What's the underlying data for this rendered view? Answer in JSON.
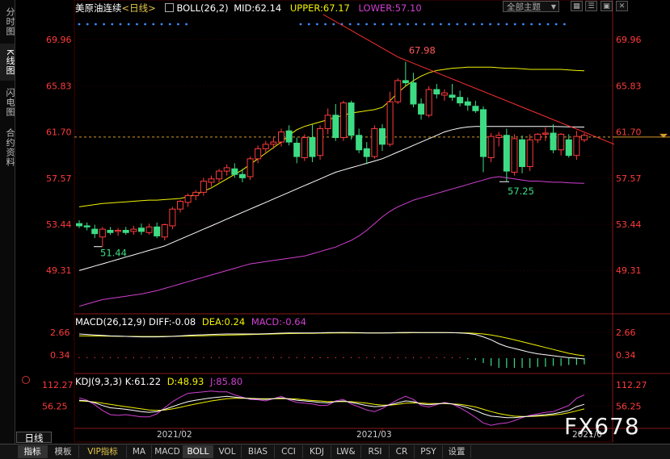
{
  "left_rail": [
    {
      "label": "分时图",
      "active": false
    },
    {
      "label": "K线图",
      "active": true
    },
    {
      "label": "闪电图",
      "active": false
    },
    {
      "label": "合约资料",
      "active": false
    }
  ],
  "header": {
    "instrument": "美原油连续",
    "period": "<日线>",
    "indicator": "BOLL(26,2)",
    "mid": "MID:62.14",
    "upper": "UPPER:67.17",
    "lower": "LOWER:57.10",
    "theme": "全部主题",
    "theme_arrow": "▼"
  },
  "macd_header": {
    "name": "MACD(26,12,9)",
    "diff": "DIFF:-0.08",
    "dea": "DEA:0.24",
    "macd": "MACD:-0.64"
  },
  "kdj_header": {
    "name": "KDJ(9,3,3)",
    "k": "K:61.22",
    "d": "D:48.93",
    "j": "J:85.80"
  },
  "date_labels": [
    "2021/02",
    "2021/03",
    "2021/0"
  ],
  "period_label": "日线",
  "bottom_tabs": [
    {
      "label": "指标",
      "active": true
    },
    {
      "label": "模板",
      "active": false
    },
    {
      "label": "VIP指标",
      "active": false,
      "vip": true
    },
    {
      "label": "MA",
      "active": false
    },
    {
      "label": "MACD",
      "active": false
    },
    {
      "label": "BOLL",
      "active": true
    },
    {
      "label": "VOL",
      "active": false
    },
    {
      "label": "BIAS",
      "active": false
    },
    {
      "label": "CCI",
      "active": false
    },
    {
      "label": "KDJ",
      "active": false
    },
    {
      "label": "LW&",
      "active": false
    },
    {
      "label": "RSI",
      "active": false
    },
    {
      "label": "CR",
      "active": false
    },
    {
      "label": "PSY",
      "active": false
    },
    {
      "label": "设置",
      "active": false
    }
  ],
  "watermark": "FX678",
  "colors": {
    "up": "#ff3b3b",
    "down": "#3ddc84",
    "upper": "#f2f200",
    "mid": "#ffffff",
    "lower": "#d040d0",
    "axis": "#ff3b3b",
    "trend": "#ff3030",
    "dea": "#f2f200",
    "diff": "#ffffff"
  },
  "chart_data": [
    {
      "type": "candlestick",
      "title": "美原油连续 <日线>",
      "indicator": "BOLL(26,2)",
      "ylim": [
        45.5,
        72.5
      ],
      "y_ticks": [
        "69.96",
        "65.83",
        "61.70",
        "57.57",
        "53.44",
        "49.31"
      ],
      "current_price": 61.25,
      "annotations": [
        {
          "text": "67.98",
          "value": 67.98,
          "type": "high"
        },
        {
          "text": "51.44",
          "value": 51.44,
          "type": "low"
        },
        {
          "text": "57.25",
          "value": 57.25,
          "type": "low"
        }
      ],
      "candles": [
        {
          "o": 53.5,
          "h": 53.8,
          "l": 53.1,
          "c": 53.3
        },
        {
          "o": 53.3,
          "h": 53.6,
          "l": 52.9,
          "c": 53.2
        },
        {
          "o": 53.0,
          "h": 53.4,
          "l": 52.2,
          "c": 52.6
        },
        {
          "o": 52.3,
          "h": 53.2,
          "l": 51.4,
          "c": 53.0
        },
        {
          "o": 52.9,
          "h": 53.2,
          "l": 52.5,
          "c": 52.7
        },
        {
          "o": 52.8,
          "h": 53.1,
          "l": 52.4,
          "c": 52.9
        },
        {
          "o": 52.9,
          "h": 53.2,
          "l": 52.5,
          "c": 52.7
        },
        {
          "o": 52.8,
          "h": 53.3,
          "l": 52.5,
          "c": 53.0
        },
        {
          "o": 53.1,
          "h": 53.5,
          "l": 52.5,
          "c": 52.8
        },
        {
          "o": 52.7,
          "h": 53.5,
          "l": 52.5,
          "c": 53.2
        },
        {
          "o": 53.2,
          "h": 53.6,
          "l": 52.2,
          "c": 52.4
        },
        {
          "o": 52.3,
          "h": 53.5,
          "l": 52.0,
          "c": 53.4
        },
        {
          "o": 53.3,
          "h": 55.0,
          "l": 53.0,
          "c": 54.8
        },
        {
          "o": 54.8,
          "h": 55.6,
          "l": 54.5,
          "c": 55.5
        },
        {
          "o": 55.4,
          "h": 56.2,
          "l": 55.0,
          "c": 56.0
        },
        {
          "o": 56.0,
          "h": 56.5,
          "l": 55.6,
          "c": 56.3
        },
        {
          "o": 56.3,
          "h": 57.6,
          "l": 56.0,
          "c": 57.3
        },
        {
          "o": 57.2,
          "h": 57.8,
          "l": 56.8,
          "c": 57.5
        },
        {
          "o": 57.5,
          "h": 58.4,
          "l": 57.2,
          "c": 58.2
        },
        {
          "o": 58.2,
          "h": 58.8,
          "l": 57.8,
          "c": 58.5
        },
        {
          "o": 58.4,
          "h": 58.9,
          "l": 57.6,
          "c": 57.9
        },
        {
          "o": 57.9,
          "h": 58.4,
          "l": 57.2,
          "c": 57.6
        },
        {
          "o": 57.7,
          "h": 59.5,
          "l": 57.4,
          "c": 59.3
        },
        {
          "o": 59.3,
          "h": 60.5,
          "l": 58.9,
          "c": 60.2
        },
        {
          "o": 60.2,
          "h": 60.9,
          "l": 59.8,
          "c": 60.6
        },
        {
          "o": 60.6,
          "h": 61.2,
          "l": 60.2,
          "c": 60.8
        },
        {
          "o": 60.8,
          "h": 62.0,
          "l": 60.4,
          "c": 61.7
        },
        {
          "o": 61.8,
          "h": 62.3,
          "l": 60.5,
          "c": 60.8
        },
        {
          "o": 60.7,
          "h": 61.2,
          "l": 58.9,
          "c": 59.5
        },
        {
          "o": 59.4,
          "h": 61.5,
          "l": 59.1,
          "c": 61.2
        },
        {
          "o": 61.2,
          "h": 62.4,
          "l": 59.0,
          "c": 59.5
        },
        {
          "o": 59.6,
          "h": 62.3,
          "l": 59.2,
          "c": 62.0
        },
        {
          "o": 62.0,
          "h": 63.8,
          "l": 61.5,
          "c": 63.2
        },
        {
          "o": 63.2,
          "h": 64.2,
          "l": 60.9,
          "c": 61.2
        },
        {
          "o": 61.2,
          "h": 64.5,
          "l": 60.9,
          "c": 64.3
        },
        {
          "o": 64.3,
          "h": 64.5,
          "l": 61.0,
          "c": 61.4
        },
        {
          "o": 61.4,
          "h": 62.0,
          "l": 59.8,
          "c": 60.1
        },
        {
          "o": 60.2,
          "h": 60.8,
          "l": 58.8,
          "c": 59.5
        },
        {
          "o": 59.5,
          "h": 62.3,
          "l": 59.3,
          "c": 62.0
        },
        {
          "o": 62.0,
          "h": 62.4,
          "l": 60.0,
          "c": 60.6
        },
        {
          "o": 60.6,
          "h": 65.3,
          "l": 60.4,
          "c": 64.4
        },
        {
          "o": 64.4,
          "h": 66.5,
          "l": 64.2,
          "c": 66.3
        },
        {
          "o": 66.3,
          "h": 67.98,
          "l": 65.8,
          "c": 66.1
        },
        {
          "o": 66.1,
          "h": 67.0,
          "l": 63.9,
          "c": 64.2
        },
        {
          "o": 64.2,
          "h": 64.7,
          "l": 62.8,
          "c": 63.3
        },
        {
          "o": 63.2,
          "h": 65.8,
          "l": 63.0,
          "c": 65.5
        },
        {
          "o": 65.5,
          "h": 66.0,
          "l": 64.7,
          "c": 65.1
        },
        {
          "o": 65.0,
          "h": 65.5,
          "l": 64.5,
          "c": 65.2
        },
        {
          "o": 65.0,
          "h": 66.0,
          "l": 64.5,
          "c": 64.8
        },
        {
          "o": 64.8,
          "h": 65.4,
          "l": 64.0,
          "c": 64.3
        },
        {
          "o": 64.4,
          "h": 64.8,
          "l": 63.6,
          "c": 64.1
        },
        {
          "o": 64.0,
          "h": 64.5,
          "l": 63.4,
          "c": 63.6
        },
        {
          "o": 63.7,
          "h": 64.0,
          "l": 58.1,
          "c": 59.5
        },
        {
          "o": 59.4,
          "h": 61.6,
          "l": 59.0,
          "c": 61.3
        },
        {
          "o": 61.2,
          "h": 61.7,
          "l": 60.4,
          "c": 61.4
        },
        {
          "o": 61.4,
          "h": 62.0,
          "l": 57.3,
          "c": 58.2
        },
        {
          "o": 58.1,
          "h": 61.5,
          "l": 57.8,
          "c": 61.1
        },
        {
          "o": 61.0,
          "h": 61.4,
          "l": 58.0,
          "c": 58.6
        },
        {
          "o": 58.6,
          "h": 61.5,
          "l": 58.2,
          "c": 61.0
        },
        {
          "o": 61.0,
          "h": 61.6,
          "l": 60.7,
          "c": 61.5
        },
        {
          "o": 61.5,
          "h": 62.1,
          "l": 60.9,
          "c": 61.6
        },
        {
          "o": 61.6,
          "h": 62.4,
          "l": 59.8,
          "c": 60.1
        },
        {
          "o": 60.1,
          "h": 61.6,
          "l": 59.6,
          "c": 61.5
        },
        {
          "o": 61.0,
          "h": 61.5,
          "l": 59.4,
          "c": 59.6
        },
        {
          "o": 59.6,
          "h": 61.8,
          "l": 59.2,
          "c": 61.3
        },
        {
          "o": 61.0,
          "h": 61.6,
          "l": 60.8,
          "c": 61.4
        }
      ],
      "upper": [
        55.0,
        55.1,
        55.2,
        55.3,
        55.35,
        55.4,
        55.45,
        55.5,
        55.55,
        55.6,
        55.6,
        55.65,
        55.7,
        55.75,
        55.9,
        56.1,
        56.4,
        56.7,
        57.1,
        57.5,
        57.9,
        58.3,
        58.8,
        59.3,
        59.8,
        60.3,
        60.8,
        61.4,
        61.9,
        62.2,
        62.4,
        62.6,
        62.8,
        63.0,
        63.2,
        63.4,
        63.5,
        63.6,
        63.7,
        63.9,
        64.5,
        65.2,
        65.8,
        66.3,
        66.7,
        67.0,
        67.2,
        67.3,
        67.4,
        67.45,
        67.5,
        67.5,
        67.5,
        67.5,
        67.45,
        67.4,
        67.4,
        67.35,
        67.3,
        67.3,
        67.3,
        67.3,
        67.3,
        67.25,
        67.2,
        67.17
      ],
      "mid": [
        49.3,
        49.5,
        49.7,
        49.9,
        50.1,
        50.3,
        50.5,
        50.7,
        50.9,
        51.1,
        51.3,
        51.5,
        51.8,
        52.1,
        52.4,
        52.7,
        53.0,
        53.3,
        53.6,
        53.9,
        54.2,
        54.5,
        54.8,
        55.1,
        55.4,
        55.7,
        56.0,
        56.3,
        56.6,
        56.9,
        57.2,
        57.5,
        57.8,
        58.1,
        58.3,
        58.5,
        58.7,
        58.9,
        59.1,
        59.3,
        59.6,
        59.9,
        60.2,
        60.5,
        60.8,
        61.1,
        61.4,
        61.7,
        61.9,
        62.05,
        62.15,
        62.2,
        62.2,
        62.2,
        62.2,
        62.2,
        62.2,
        62.2,
        62.2,
        62.2,
        62.2,
        62.2,
        62.18,
        62.16,
        62.15,
        62.14
      ],
      "lower": [
        46.1,
        46.3,
        46.5,
        46.7,
        46.8,
        46.9,
        47.0,
        47.1,
        47.2,
        47.35,
        47.5,
        47.7,
        47.9,
        48.1,
        48.3,
        48.5,
        48.7,
        48.9,
        49.1,
        49.3,
        49.5,
        49.7,
        49.9,
        50.0,
        50.1,
        50.2,
        50.3,
        50.4,
        50.5,
        50.6,
        50.8,
        51.0,
        51.2,
        51.4,
        51.7,
        52.0,
        52.4,
        52.9,
        53.5,
        54.1,
        54.6,
        55.0,
        55.3,
        55.6,
        55.8,
        56.0,
        56.2,
        56.4,
        56.6,
        56.8,
        57.0,
        57.2,
        57.4,
        57.6,
        57.7,
        57.6,
        57.5,
        57.4,
        57.3,
        57.3,
        57.25,
        57.2,
        57.2,
        57.15,
        57.12,
        57.1
      ]
    },
    {
      "type": "line",
      "title": "MACD(26,12,9)",
      "ylim": [
        -1.0,
        4.0
      ],
      "y_ticks": [
        "2.66",
        "0.34"
      ],
      "series": [
        {
          "name": "DIFF",
          "values": [
            2.5,
            2.45,
            2.4,
            2.35,
            2.3,
            2.28,
            2.25,
            2.22,
            2.2,
            2.2,
            2.2,
            2.22,
            2.25,
            2.3,
            2.35,
            2.4,
            2.42,
            2.45,
            2.48,
            2.5,
            2.5,
            2.5,
            2.5,
            2.5,
            2.52,
            2.55,
            2.58,
            2.6,
            2.6,
            2.6,
            2.6,
            2.62,
            2.65,
            2.65,
            2.66,
            2.65,
            2.63,
            2.6,
            2.6,
            2.6,
            2.62,
            2.65,
            2.66,
            2.66,
            2.64,
            2.64,
            2.64,
            2.64,
            2.63,
            2.6,
            2.55,
            2.45,
            2.2,
            1.9,
            1.5,
            1.2,
            1.0,
            0.8,
            0.6,
            0.45,
            0.35,
            0.25,
            0.15,
            0.05,
            0.0,
            -0.08
          ]
        },
        {
          "name": "DEA",
          "values": [
            2.3,
            2.3,
            2.29,
            2.28,
            2.27,
            2.26,
            2.25,
            2.25,
            2.24,
            2.24,
            2.24,
            2.25,
            2.26,
            2.27,
            2.28,
            2.3,
            2.32,
            2.34,
            2.36,
            2.38,
            2.4,
            2.42,
            2.44,
            2.46,
            2.48,
            2.5,
            2.52,
            2.54,
            2.55,
            2.56,
            2.57,
            2.58,
            2.59,
            2.6,
            2.6,
            2.6,
            2.6,
            2.6,
            2.6,
            2.6,
            2.61,
            2.62,
            2.62,
            2.63,
            2.63,
            2.63,
            2.63,
            2.63,
            2.63,
            2.62,
            2.6,
            2.56,
            2.5,
            2.4,
            2.25,
            2.08,
            1.9,
            1.7,
            1.5,
            1.3,
            1.1,
            0.9,
            0.7,
            0.5,
            0.35,
            0.24
          ]
        },
        {
          "name": "MACD",
          "values": [
            0.1,
            0.1,
            0.1,
            0.1,
            0.1,
            0.1,
            0.1,
            0.1,
            0.1,
            0.1,
            0.1,
            0.1,
            0.1,
            0.1,
            0.1,
            0.1,
            0.1,
            0.1,
            0.1,
            0.1,
            0.1,
            0.1,
            0.1,
            0.1,
            0.1,
            0.1,
            0.1,
            0.1,
            0.1,
            0.1,
            0.1,
            0.1,
            0.1,
            0.1,
            0.1,
            0.1,
            0.1,
            0.1,
            0.1,
            0.1,
            0.1,
            0.1,
            0.1,
            0.1,
            0.1,
            0.1,
            0.1,
            0.1,
            0.1,
            0.1,
            -0.1,
            -0.2,
            -0.5,
            -0.8,
            -1.0,
            -1.0,
            -1.0,
            -1.0,
            -1.0,
            -0.9,
            -0.9,
            -0.8,
            -0.8,
            -0.7,
            -0.7,
            -0.64
          ]
        }
      ]
    },
    {
      "type": "line",
      "title": "KDJ(9,3,3)",
      "ylim": [
        0,
        140
      ],
      "y_ticks": [
        "112.27",
        "56.25"
      ],
      "series": [
        {
          "name": "K",
          "values": [
            72,
            70,
            65,
            58,
            52,
            50,
            48,
            45,
            42,
            40,
            42,
            48,
            55,
            62,
            68,
            72,
            75,
            78,
            80,
            82,
            80,
            78,
            76,
            75,
            74,
            76,
            78,
            75,
            72,
            70,
            68,
            66,
            65,
            68,
            70,
            66,
            62,
            58,
            55,
            56,
            60,
            65,
            70,
            68,
            62,
            60,
            62,
            64,
            62,
            58,
            52,
            45,
            36,
            30,
            28,
            26,
            26,
            28,
            30,
            32,
            34,
            36,
            40,
            45,
            55,
            61
          ]
        },
        {
          "name": "D",
          "values": [
            70,
            69,
            67,
            64,
            61,
            58,
            55,
            52,
            49,
            46,
            45,
            46,
            49,
            53,
            58,
            62,
            66,
            70,
            73,
            76,
            77,
            77,
            77,
            76,
            76,
            76,
            76,
            76,
            75,
            73,
            71,
            70,
            68,
            68,
            68,
            68,
            66,
            64,
            61,
            59,
            59,
            61,
            64,
            65,
            64,
            63,
            63,
            63,
            62,
            61,
            58,
            54,
            48,
            42,
            37,
            33,
            30,
            29,
            29,
            30,
            31,
            33,
            35,
            39,
            44,
            48.93
          ]
        },
        {
          "name": "J",
          "values": [
            78,
            72,
            60,
            45,
            34,
            32,
            34,
            31,
            28,
            28,
            36,
            52,
            68,
            80,
            90,
            92,
            94,
            96,
            94,
            94,
            86,
            80,
            74,
            73,
            70,
            76,
            82,
            73,
            66,
            64,
            62,
            58,
            59,
            70,
            74,
            62,
            54,
            46,
            42,
            50,
            62,
            73,
            82,
            74,
            58,
            54,
            60,
            66,
            62,
            52,
            40,
            27,
            12,
            6,
            10,
            12,
            18,
            26,
            32,
            36,
            40,
            42,
            50,
            58,
            77,
            85.8
          ]
        }
      ]
    }
  ]
}
